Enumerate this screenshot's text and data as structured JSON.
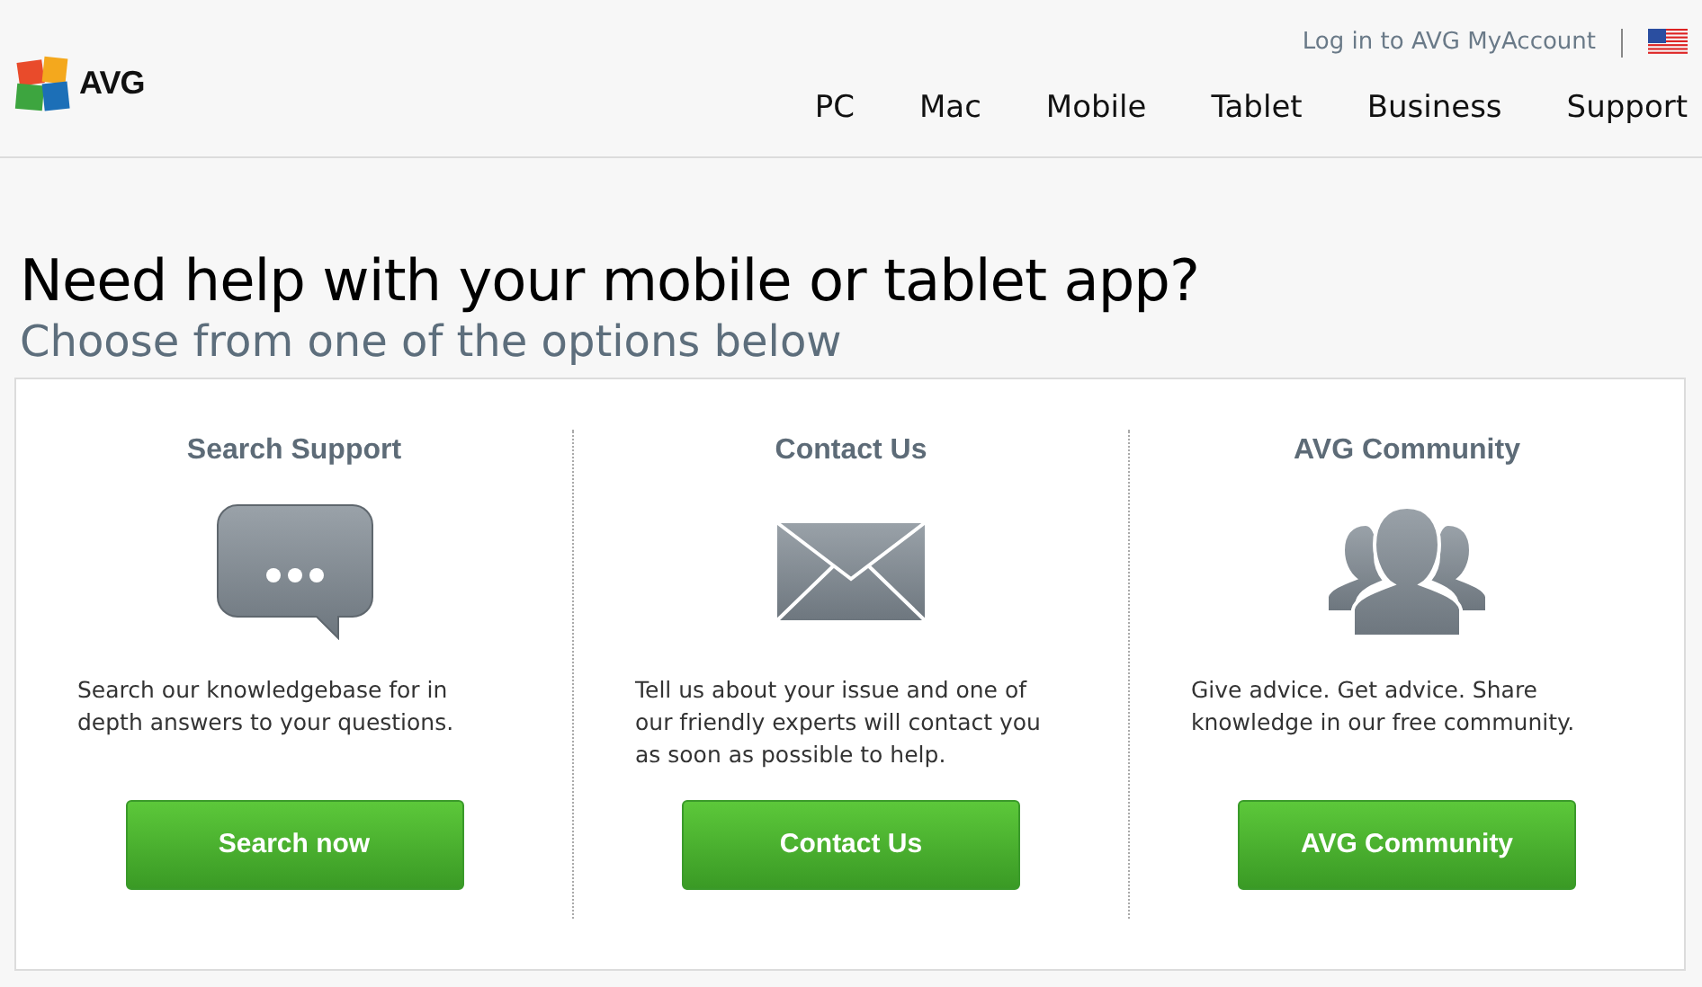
{
  "header": {
    "logo_text": "AVG",
    "login_link": "Log in to AVG MyAccount",
    "nav": [
      {
        "label": "PC"
      },
      {
        "label": "Mac"
      },
      {
        "label": "Mobile"
      },
      {
        "label": "Tablet"
      },
      {
        "label": "Business"
      },
      {
        "label": "Support"
      }
    ]
  },
  "heading": "Need help with your mobile or tablet app?",
  "subheading": "Choose from one of the options below",
  "options": [
    {
      "kind": "chat",
      "title": "Search Support",
      "description": "Search our knowledgebase for in depth answers to your questions.",
      "button": "Search now"
    },
    {
      "kind": "mail",
      "title": "Contact Us",
      "description": "Tell us about your issue and one of our friendly experts will contact you as soon as possible to help.",
      "button": "Contact Us"
    },
    {
      "kind": "people",
      "title": "AVG Community",
      "description": "Give advice. Get advice. Share knowledge in our free community.",
      "button": "AVG Community"
    }
  ]
}
